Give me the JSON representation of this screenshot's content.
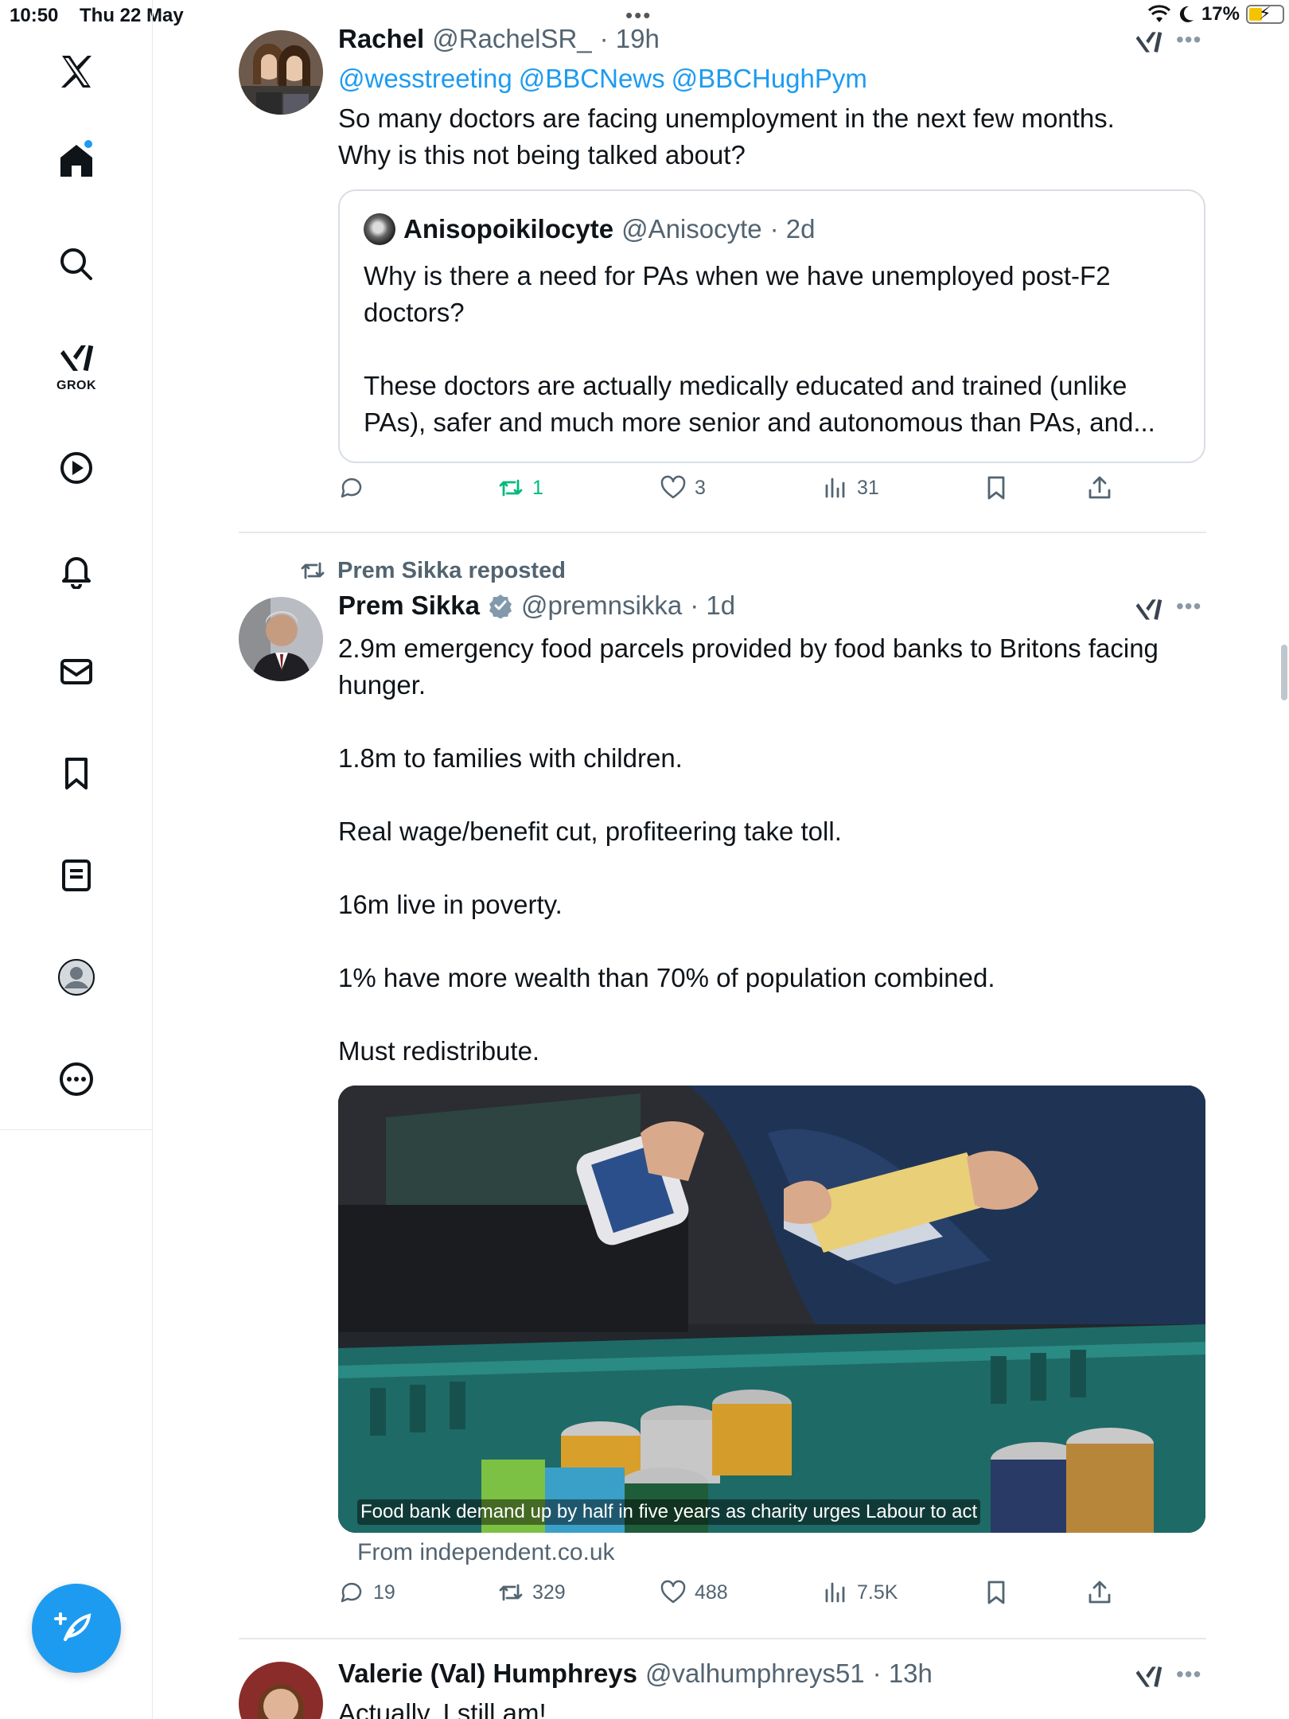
{
  "status_bar": {
    "time": "10:50",
    "date": "Thu 22 May",
    "battery": "17%"
  },
  "sidebar": {
    "items": [
      {
        "icon": "x-logo-icon"
      },
      {
        "icon": "home-icon",
        "has_notification_dot": true
      },
      {
        "icon": "search-icon"
      },
      {
        "icon": "grok-icon",
        "label": "GROK"
      },
      {
        "icon": "video-play-icon"
      },
      {
        "icon": "bell-icon"
      },
      {
        "icon": "mail-icon"
      },
      {
        "icon": "bookmark-icon"
      },
      {
        "icon": "lists-icon"
      },
      {
        "icon": "profile-icon"
      },
      {
        "icon": "more-icon"
      }
    ],
    "compose_icon": "compose-icon"
  },
  "posts": [
    {
      "author": "Rachel",
      "handle": "@RachelSR_",
      "time": "· 19h",
      "mentions": [
        "@wesstreeting",
        "@BBCNews",
        "@BBCHughPym"
      ],
      "text": "So many doctors are facing unemployment in the next few months.\nWhy is this not being talked about?",
      "quote": {
        "author": "Anisopoikilocyte",
        "handle": "@Anisocyte",
        "time": "· 2d",
        "text": "Why is there a need for PAs when we have unemployed post-F2 doctors?\n\nThese doctors are actually medically educated and trained (unlike PAs), safer and much more senior and autonomous than PAs, and..."
      },
      "actions": {
        "replies": "",
        "reposts": "1",
        "likes": "3",
        "views": "31"
      }
    },
    {
      "repost_label": "Prem Sikka reposted",
      "author": "Prem Sikka",
      "handle": "@premnsikka",
      "time": "· 1d",
      "verified": true,
      "text": "2.9m emergency food parcels provided by food banks to Britons facing hunger.\n\n1.8m to families with children.\n\nReal wage/benefit cut, profiteering take toll.\n\n16m live in poverty.\n\n1% have more wealth than 70% of population combined.\n\nMust redistribute.",
      "link_card": {
        "caption": "Food bank demand up by half in five years as charity urges Labour to act",
        "source": "From independent.co.uk"
      },
      "actions": {
        "replies": "19",
        "reposts": "329",
        "likes": "488",
        "views": "7.5K"
      }
    },
    {
      "author": "Valerie (Val) Humphreys",
      "handle": "@valhumphreys51",
      "time": "· 13h",
      "text": "Actually, I still am!"
    }
  ],
  "colors": {
    "accent": "#1d9bf0",
    "repost_active": "#00ba7c",
    "text_primary": "#0f1419",
    "text_secondary": "#536471"
  }
}
